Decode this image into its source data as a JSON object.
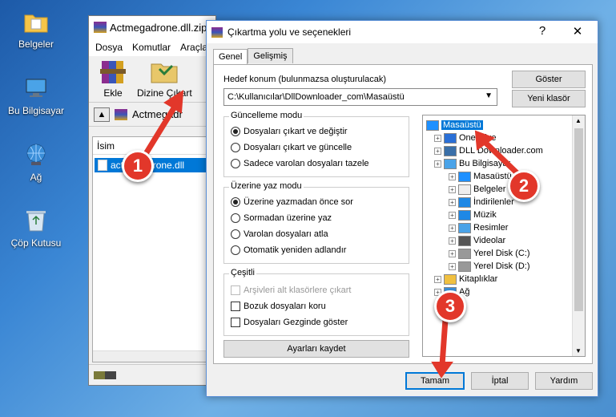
{
  "desktop": {
    "icons": [
      {
        "label": "Belgeler",
        "icon": "folder-icon"
      },
      {
        "label": "Bu Bilgisayar",
        "icon": "computer-icon"
      },
      {
        "label": "Ağ",
        "icon": "network-icon"
      },
      {
        "label": "Çöp Kutusu",
        "icon": "recycle-bin-icon"
      }
    ]
  },
  "winrar": {
    "title": "Actmegadrone.dll.zip",
    "menu": [
      "Dosya",
      "Komutlar",
      "Araçla"
    ],
    "toolbar": {
      "add_label": "Ekle",
      "extract_label": "Dizine Çıkart"
    },
    "path_text": "Actmegadr",
    "column_name": "İsim",
    "file_name": "actmegadrone.dll"
  },
  "dialog": {
    "title": "Çıkartma yolu ve seçenekleri",
    "help_glyph": "?",
    "close_glyph": "✕",
    "tabs": [
      "Genel",
      "Gelişmiş"
    ],
    "dest_label": "Hedef konum (bulunmazsa oluşturulacak)",
    "dest_value": "C:\\Kullanıcılar\\DllDownloader_com\\Masaüstü",
    "show_button": "Göster",
    "new_folder_button": "Yeni klasör",
    "update_mode": {
      "title": "Güncelleme modu",
      "options": [
        "Dosyaları çıkart ve değiştir",
        "Dosyaları çıkart ve güncelle",
        "Sadece varolan dosyaları tazele"
      ],
      "selected": 0
    },
    "overwrite_mode": {
      "title": "Üzerine yaz modu",
      "options": [
        "Üzerine yazmadan önce sor",
        "Sormadan üzerine yaz",
        "Varolan dosyaları atla",
        "Otomatik yeniden adlandır"
      ],
      "selected": 0
    },
    "misc": {
      "title": "Çeşitli",
      "options": [
        "Arşivleri alt klasörlere çıkart",
        "Bozuk dosyaları koru",
        "Dosyaları Gezginde göster"
      ]
    },
    "save_settings_button": "Ayarları kaydet",
    "tree": [
      {
        "label": "Masaüstü",
        "level": 0,
        "selected": true,
        "icon": "desktop-icon"
      },
      {
        "label": "OneDrive",
        "level": 1,
        "icon": "cloud-icon"
      },
      {
        "label": "DLL Downloader.com",
        "level": 1,
        "icon": "user-icon"
      },
      {
        "label": "Bu Bilgisayar",
        "level": 1,
        "icon": "computer-icon"
      },
      {
        "label": "Masaüstü",
        "level": 2,
        "icon": "desktop-icon"
      },
      {
        "label": "Belgeler",
        "level": 2,
        "icon": "document-icon"
      },
      {
        "label": "İndirilenler",
        "level": 2,
        "icon": "download-icon"
      },
      {
        "label": "Müzik",
        "level": 2,
        "icon": "music-icon"
      },
      {
        "label": "Resimler",
        "level": 2,
        "icon": "picture-icon"
      },
      {
        "label": "Videolar",
        "level": 2,
        "icon": "video-icon"
      },
      {
        "label": "Yerel Disk (C:)",
        "level": 2,
        "icon": "disk-icon"
      },
      {
        "label": "Yerel Disk (D:)",
        "level": 2,
        "icon": "disk-icon"
      },
      {
        "label": "Kitaplıklar",
        "level": 1,
        "icon": "library-icon"
      },
      {
        "label": "Ağ",
        "level": 1,
        "icon": "network-icon"
      }
    ],
    "ok_button": "Tamam",
    "cancel_button": "İptal",
    "help_button": "Yardım"
  },
  "annotations": [
    "1",
    "2",
    "3"
  ],
  "colors": {
    "selection": "#0078d7",
    "marker": "#e2372a",
    "arrow": "#e2372a"
  }
}
